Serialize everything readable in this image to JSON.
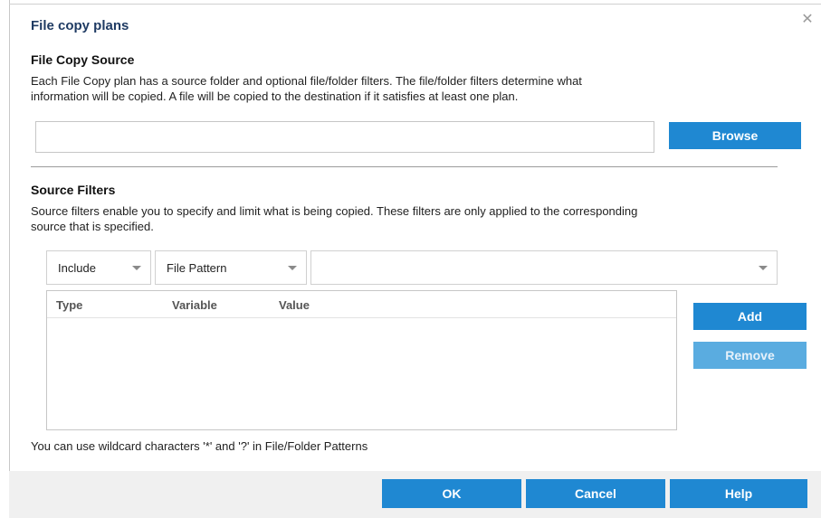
{
  "dialog": {
    "title": "File copy plans",
    "close_icon": "close-icon"
  },
  "source": {
    "title": "File Copy Source",
    "description_line1": "Each File Copy plan has a source folder and optional file/folder filters. The file/folder filters determine what",
    "description_line2": "information will be copied. A file will be copied to the destination if it satisfies at least one plan.",
    "path_value": "",
    "browse_label": "Browse"
  },
  "filters": {
    "title": "Source Filters",
    "description_line1": "Source filters enable you to specify and limit what is being copied. These filters are only applied to the corresponding",
    "description_line2": "source that is specified.",
    "include_select": "Include",
    "type_select": "File Pattern",
    "value_select": "",
    "columns": [
      "Type",
      "Variable",
      "Value"
    ],
    "rows": [],
    "add_label": "Add",
    "remove_label": "Remove",
    "hint": "You can use wildcard characters '*' and '?' in File/Folder Patterns"
  },
  "footer": {
    "ok_label": "OK",
    "cancel_label": "Cancel",
    "help_label": "Help"
  },
  "colors": {
    "accent": "#1f88d2",
    "accent_disabled": "#5aace0",
    "title": "#1f3b63",
    "footer_bg": "#f0f0f0"
  }
}
